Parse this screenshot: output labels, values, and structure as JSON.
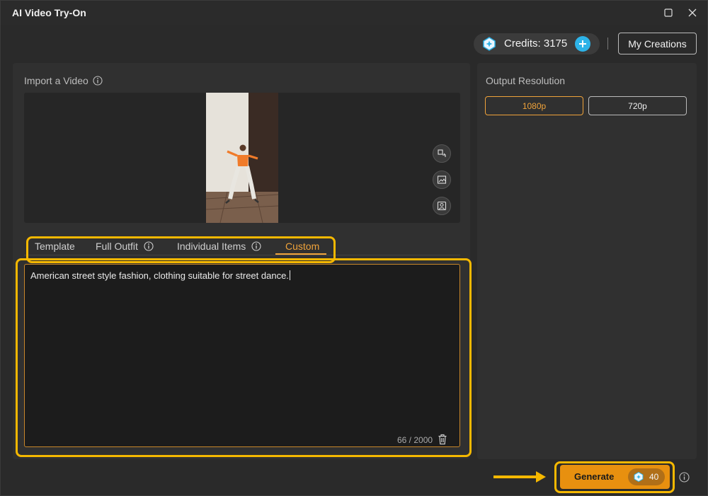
{
  "app": {
    "title": "AI Video Try-On"
  },
  "header": {
    "credits_label": "Credits: 3175",
    "my_creations_label": "My Creations"
  },
  "import": {
    "label": "Import a Video"
  },
  "tabs": [
    {
      "label": "Template"
    },
    {
      "label": "Full Outfit"
    },
    {
      "label": "Individual Items"
    },
    {
      "label": "Custom"
    }
  ],
  "prompt": {
    "value": "American street style fashion, clothing suitable for street dance.",
    "char_count": "66 / 2000"
  },
  "output": {
    "label": "Output Resolution",
    "options": [
      "1080p",
      "720p"
    ],
    "selected": "1080p"
  },
  "generate": {
    "label": "Generate",
    "cost": "40"
  },
  "colors": {
    "accent": "#f0a33a",
    "highlight": "#f5b800",
    "credits_plus": "#2db3e8",
    "generate_bg": "#e8900f"
  }
}
